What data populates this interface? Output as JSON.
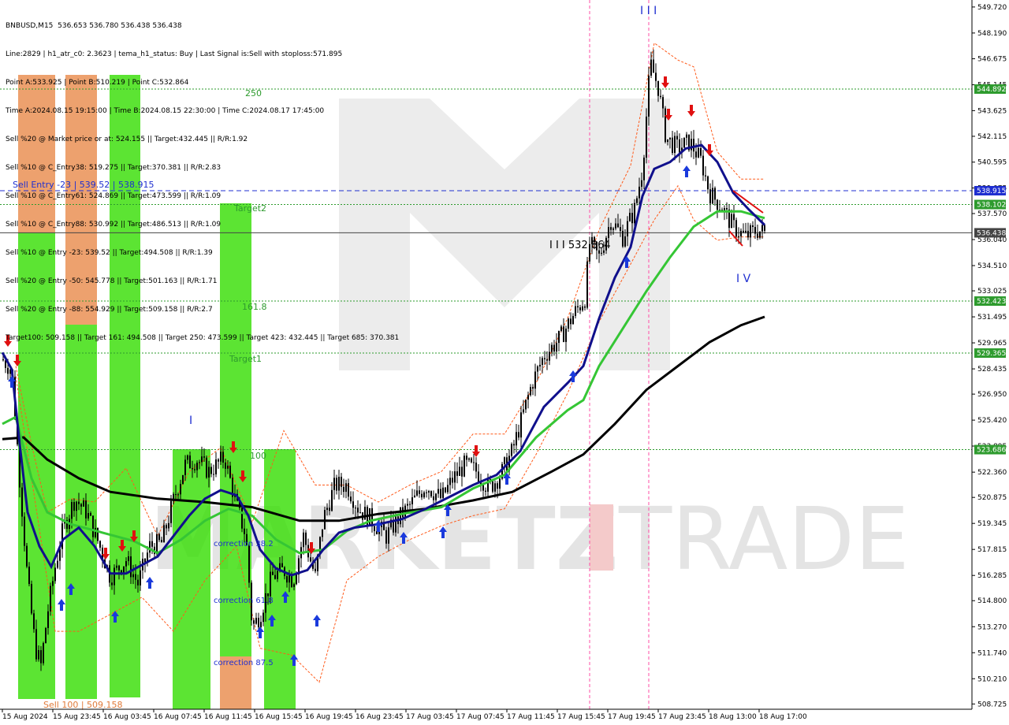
{
  "info_lines": [
    "BNBUSD,M15  536.653 536.780 536.438 536.438",
    "Line:2829 | h1_atr_c0: 2.3623 | tema_h1_status: Buy | Last Signal is:Sell with stoploss:571.895",
    "Point A:533.925 | Point B:510.219 | Point C:532.864",
    "Time A:2024.08.15 19:15:00 | Time B:2024.08.15 22:30:00 | Time C:2024.08.17 17:45:00",
    "Sell %20 @ Market price or at: 524.155 || Target:432.445 || R/R:1.92",
    "Sell %10 @ C_Entry38: 519.275 || Target:370.381 || R/R:2.83",
    "Sell %10 @ C_Entry61: 524.869 || Target:473.599 || R/R:1.09",
    "Sell %10 @ C_Entry88: 530.992 || Target:486.513 || R/R:1.09",
    "Sell %10 @ Entry -23: 539.52 || Target:494.508 || R/R:1.39",
    "Sell %20 @ Entry -50: 545.778 || Target:501.163 || R/R:1.71",
    "Sell %20 @ Entry -88: 554.929 || Target:509.158 || R/R:2.7",
    "Target100: 509.158 || Target 161: 494.508 || Target 250: 473.599 || Target 423: 432.445 || Target 685: 370.381"
  ],
  "watermark": {
    "left": "MARKETZ",
    "right": "TRADE"
  },
  "chart_data": {
    "type": "candlestick",
    "symbol": "BNBUSD",
    "timeframe": "M15",
    "ohlc_last": {
      "open": 536.653,
      "high": 536.78,
      "low": 536.438,
      "close": 536.438
    },
    "ylim": [
      508.6,
      549.9
    ],
    "y_ticks": [
      "549.720",
      "548.190",
      "546.675",
      "545.145",
      "543.625",
      "542.115",
      "540.595",
      "539.075",
      "537.570",
      "536.040",
      "534.510",
      "533.025",
      "531.495",
      "529.965",
      "528.435",
      "526.950",
      "525.420",
      "523.895",
      "522.360",
      "520.875",
      "519.345",
      "517.815",
      "516.285",
      "514.800",
      "513.270",
      "511.740",
      "510.210",
      "508.725"
    ],
    "x_labels": [
      "15 Aug 2024",
      "15 Aug 23:45",
      "16 Aug 03:45",
      "16 Aug 07:45",
      "16 Aug 11:45",
      "16 Aug 15:45",
      "16 Aug 19:45",
      "16 Aug 23:45",
      "17 Aug 03:45",
      "17 Aug 07:45",
      "17 Aug 11:45",
      "17 Aug 15:45",
      "17 Aug 19:45",
      "17 Aug 23:45",
      "18 Aug 13:00",
      "18 Aug 17:00"
    ],
    "price_levels": [
      {
        "value": 544.892,
        "label": "544.892",
        "color": "#2e9b2e",
        "style": "dotted"
      },
      {
        "value": 538.915,
        "label": "538.915",
        "color": "#1f2fd0",
        "style": "dashed"
      },
      {
        "value": 538.102,
        "label": "538.102",
        "color": "#2e9b2e",
        "style": "dotted"
      },
      {
        "value": 536.438,
        "label": "536.438",
        "color": "#444444",
        "style": "solid"
      },
      {
        "value": 532.423,
        "label": "532.423",
        "color": "#2e9b2e",
        "style": "dotted"
      },
      {
        "value": 529.365,
        "label": "529.365",
        "color": "#2e9b2e",
        "style": "dotted"
      },
      {
        "value": 523.686,
        "label": "523.686",
        "color": "#2e9b2e",
        "style": "dotted"
      }
    ],
    "annotations": [
      {
        "text": "Sell Entry -23 | 539.52 | 538.915",
        "color": "#1f2fd0"
      },
      {
        "text": "250",
        "color": "#2e9b2e"
      },
      {
        "text": "Target2",
        "color": "#2e9b2e"
      },
      {
        "text": "161.8",
        "color": "#2e9b2e"
      },
      {
        "text": "Target1",
        "color": "#2e9b2e"
      },
      {
        "text": "100",
        "color": "#2e9b2e"
      },
      {
        "text": "correction 38.2",
        "color": "#1f2fd0"
      },
      {
        "text": "correction 61.8",
        "color": "#1f2fd0"
      },
      {
        "text": "correction 87.5",
        "color": "#1f2fd0"
      },
      {
        "text": "Sell 100 | 509.158",
        "color": "#e07a3a"
      },
      {
        "text": "I I I 532.864",
        "color": "#000000"
      },
      {
        "text": "I",
        "color": "#1f2fd0"
      },
      {
        "text": "I I I",
        "color": "#1f2fd0"
      },
      {
        "text": "I V",
        "color": "#1f2fd0"
      }
    ],
    "series": [
      {
        "name": "",
        "color": "#000000"
      },
      {
        "name": "",
        "color": "#35c635"
      },
      {
        "name": "",
        "color": "#10108c"
      }
    ],
    "colors": {
      "zone_green": "#33dd00",
      "zone_orange": "#e88a4a",
      "buy_arrow": "#1a3adc",
      "sell_arrow": "#e01010",
      "channel": "#ff5a1a"
    }
  }
}
